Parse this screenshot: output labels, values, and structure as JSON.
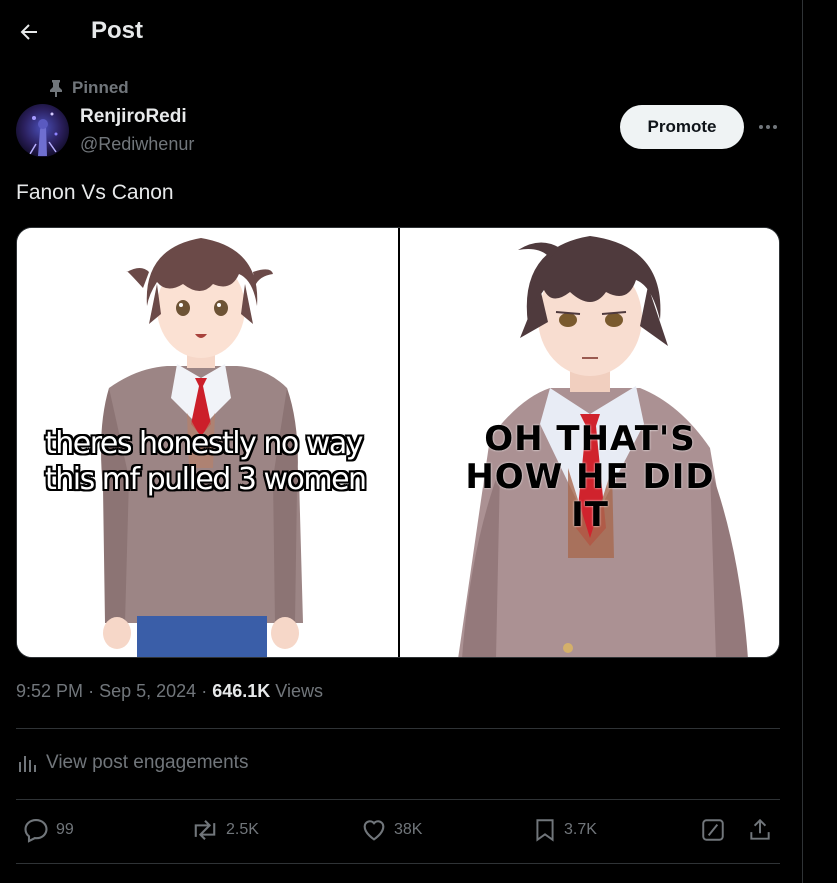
{
  "header": {
    "title": "Post"
  },
  "pinned": {
    "label": "Pinned"
  },
  "author": {
    "display_name": "RenjiroRedi",
    "handle": "@Rediwhenur"
  },
  "promote": {
    "label": "Promote"
  },
  "post": {
    "text": "Fanon Vs Canon"
  },
  "media": {
    "left_caption_line1": "theres honestly no way",
    "left_caption_line2": "this mf pulled 3 women",
    "right_caption_line1": "OH THAT'S",
    "right_caption_line2": "HOW HE DID",
    "right_caption_line3": "IT"
  },
  "meta": {
    "time": "9:52 PM",
    "date": "Sep 5, 2024",
    "views_count": "646.1K",
    "views_label": "Views",
    "separator": "·"
  },
  "engagements": {
    "label": "View post engagements"
  },
  "actions": {
    "replies": "99",
    "reposts": "2.5K",
    "likes": "38K",
    "bookmarks": "3.7K"
  },
  "icons": {
    "back": "arrow-left-icon",
    "pin": "pin-icon",
    "more": "more-horizontal-icon",
    "engagements": "analytics-icon",
    "reply": "reply-icon",
    "repost": "repost-icon",
    "like": "heart-icon",
    "bookmark": "bookmark-icon",
    "grok": "grok-icon",
    "share": "share-icon"
  },
  "colors": {
    "background": "#000000",
    "text": "#e7e9ea",
    "muted": "#71767b",
    "divider": "#2f3336",
    "promote_bg": "#eff3f4"
  }
}
